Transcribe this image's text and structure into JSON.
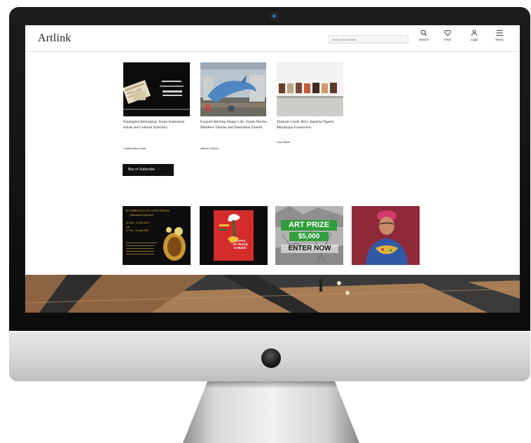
{
  "site": {
    "logo": "Artlink"
  },
  "header": {
    "search_placeholder": "Search the website...",
    "nav": [
      {
        "label": "Search",
        "icon": "search-icon"
      },
      {
        "label": "Favs",
        "icon": "heart-icon"
      },
      {
        "label": "Login",
        "icon": "user-icon"
      },
      {
        "label": "Menu",
        "icon": "hamburger-icon"
      }
    ]
  },
  "articles": [
    {
      "title": "Entangled Belonging: Asian Australian artists and cultural hybridity",
      "author": "Cristea Nian Zhao"
    },
    {
      "title": "Expand Moving Image Lab: Susan Norrie, Matthew Thorne and Emeraline Zanelli",
      "author": "Allison Chhom"
    },
    {
      "title": "Tennant Creek Brio: Japarrta Ngarta Minjinypa Iconocrisis",
      "author": "Lisa Slade"
    }
  ],
  "subscribe": {
    "label": "Buy or Subscribe",
    "arrow": "›"
  },
  "ads": [
    {
      "heading": "SOVEREIGN ACTS | LOVE PRAXIS",
      "subheading": "Unbound Collective",
      "lines": [
        "30 Sept – 22 Dec 2023",
        "and",
        "17 Feb – 21 April 2024"
      ]
    },
    {
      "lines": [
        "3 DAYS",
        "OF PEACE",
        "& MUSIC"
      ]
    },
    {
      "badge": "ART PRIZE",
      "amount": "$5,000",
      "cta": "ENTER NOW"
    },
    {}
  ],
  "colors": {
    "header_bg": "#ffffff",
    "button_bg": "#111111",
    "prize_green": "#2f9e3c",
    "poster_red": "#d42b2b"
  }
}
